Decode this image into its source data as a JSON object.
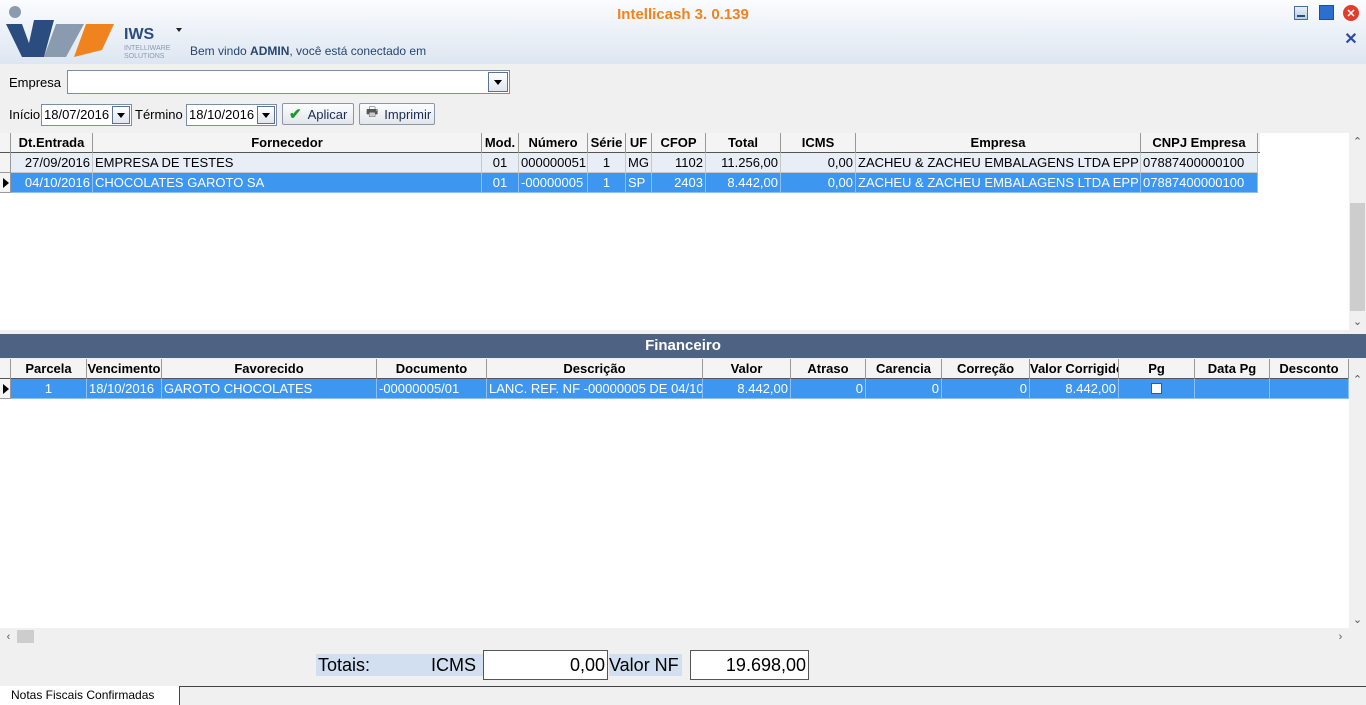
{
  "app": {
    "title": "Intellicash 3. 0.139",
    "logo_text": "IWS",
    "logo_sub1": "INTELLIWARE",
    "logo_sub2": "SOLUTIONS",
    "welcome_pre": "Bem vindo ",
    "welcome_user": "ADMIN",
    "welcome_post": ", você está conectado em"
  },
  "filters": {
    "empresa_label": "Empresa",
    "empresa_value": "",
    "inicio_label": "Início",
    "inicio_value": "18/07/2016",
    "termino_label": "Término",
    "termino_value": "18/10/2016",
    "aplicar_label": "Aplicar",
    "imprimir_label": "Imprimir"
  },
  "notas": {
    "columns": [
      "Dt.Entrada",
      "Fornecedor",
      "Mod.",
      "Número",
      "Série",
      "UF",
      "CFOP",
      "Total",
      "ICMS",
      "Empresa",
      "CNPJ Empresa"
    ],
    "rows": [
      {
        "dt": "27/09/2016",
        "fornecedor": "EMPRESA DE TESTES",
        "mod": "01",
        "numero": "000000051",
        "serie": "1",
        "uf": "MG",
        "cfop": "1102",
        "total": "11.256,00",
        "icms": "0,00",
        "empresa": "ZACHEU & ZACHEU EMBALAGENS LTDA EPP",
        "cnpj": "07887400000100"
      },
      {
        "dt": "04/10/2016",
        "fornecedor": "CHOCOLATES GAROTO SA",
        "mod": "01",
        "numero": "-00000005",
        "serie": "1",
        "uf": "SP",
        "cfop": "2403",
        "total": "8.442,00",
        "icms": "0,00",
        "empresa": "ZACHEU & ZACHEU EMBALAGENS LTDA EPP",
        "cnpj": "07887400000100"
      }
    ]
  },
  "financeiro": {
    "title": "Financeiro",
    "columns": [
      "Parcela",
      "Vencimento",
      "Favorecido",
      "Documento",
      "Descrição",
      "Valor",
      "Atraso",
      "Carencia",
      "Correção",
      "Valor Corrigido",
      "Pg",
      "Data Pg",
      "Desconto"
    ],
    "rows": [
      {
        "parcela": "1",
        "vencimento": "18/10/2016",
        "favorecido": "GAROTO CHOCOLATES",
        "documento": "-00000005/01",
        "descricao": "LANC. REF. NF -00000005 DE 04/10",
        "valor": "8.442,00",
        "atraso": "0",
        "carencia": "0",
        "correcao": "0",
        "valor_corrigido": "8.442,00",
        "pg": false,
        "data_pg": "",
        "desconto": ""
      }
    ]
  },
  "totais": {
    "label": "Totais:",
    "icms_label": "ICMS",
    "icms_value": "0,00",
    "valor_nf_label": "Valor NF",
    "valor_nf_value": "19.698,00"
  },
  "tabs": [
    {
      "label": "Notas Fiscais Confirmadas"
    }
  ],
  "colors": {
    "accent": "#f0831e",
    "selection": "#3d96f0",
    "section": "#4e6384"
  }
}
